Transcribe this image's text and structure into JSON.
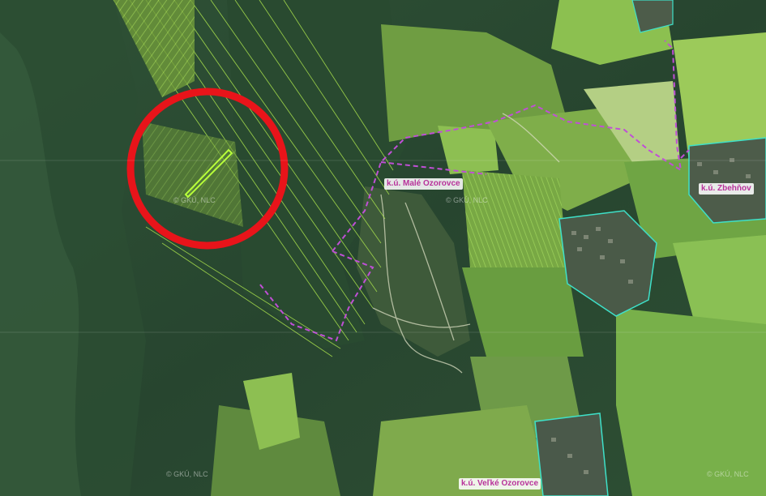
{
  "map": {
    "cadastral_areas": [
      {
        "id": "male-ozorovce",
        "label": "k.ú. Malé Ozorovce"
      },
      {
        "id": "zbehnov",
        "label": "k.ú. Zbehňov"
      },
      {
        "id": "velke-ozorovce",
        "label": "k.ú. Veľké Ozorovce"
      }
    ],
    "watermark": "© GKÚ, NLC",
    "colors": {
      "forest_dark": "#27452f",
      "forest_mid": "#36583c",
      "field_light": "#8fc04c",
      "field_bright": "#a4d85a",
      "parcel_line": "#a8e04c",
      "boundary_dashed": "#c04fd6",
      "village_outline": "#3ee0c8",
      "highlight_circle": "#e8141a",
      "selected_parcel": "#b8ff3a"
    }
  }
}
